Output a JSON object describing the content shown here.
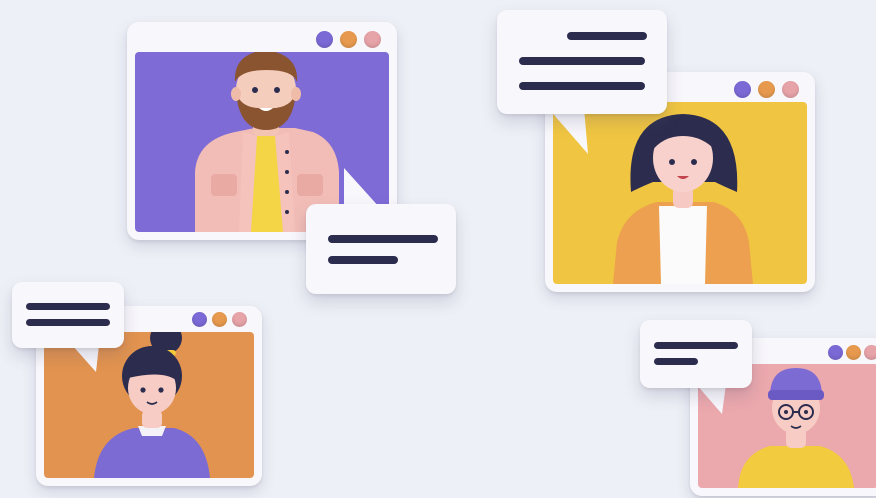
{
  "scene": {
    "description_icons": [
      "video-call-window",
      "chat-bubble",
      "avatar"
    ],
    "colors": {
      "background": "#eef0f7",
      "window_frame": "#f8f7fb",
      "dot_purple": "#7b6ad6",
      "dot_orange": "#e79a4e",
      "dot_pink": "#e6a3a8",
      "text_bar": "#2c2d4e",
      "screen_purple": "#7e6bd6",
      "screen_yellow": "#f0c541",
      "screen_orange": "#e2934f",
      "screen_pink": "#eba8ad"
    }
  }
}
